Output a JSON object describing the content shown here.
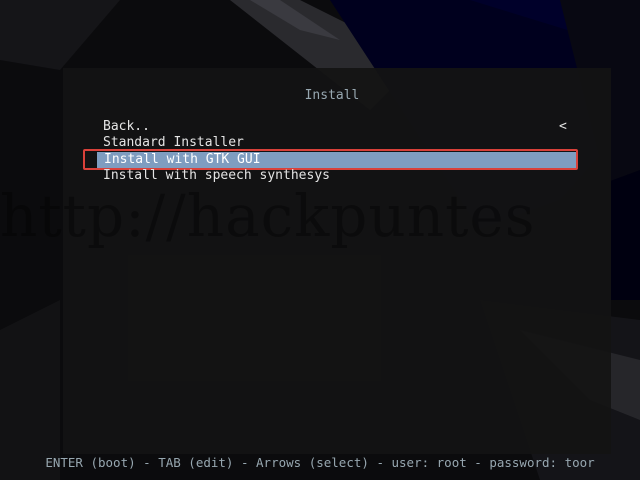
{
  "menu": {
    "title": "Install",
    "back_indicator": "<",
    "items": [
      {
        "label": "Back..",
        "selected": false
      },
      {
        "label": "Standard Installer",
        "selected": false
      },
      {
        "label": "Install with GTK GUI",
        "selected": true
      },
      {
        "label": "Install with speech synthesys",
        "selected": false
      }
    ],
    "selected_color": "#7f9dc0",
    "highlight_border_color": "#d9413a"
  },
  "watermark": "http://hackpuntes",
  "status_bar": "ENTER (boot) - TAB (edit) - Arrows (select) - user: root - password: toor"
}
